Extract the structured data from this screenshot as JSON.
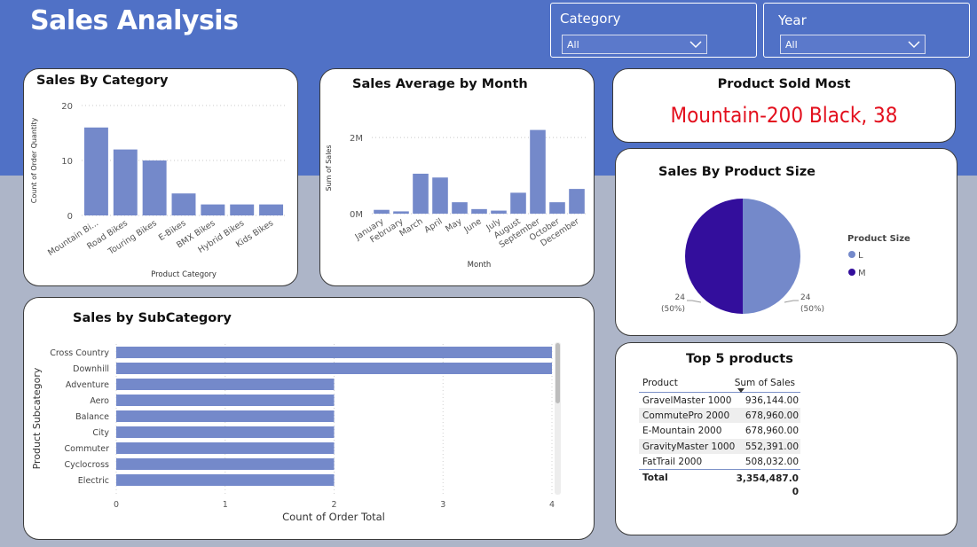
{
  "header": {
    "title": "Sales Analysis",
    "filters": [
      {
        "label": "Category",
        "value": "All"
      },
      {
        "label": "Year",
        "value": "All"
      }
    ]
  },
  "sales_by_category": {
    "title": "Sales By Category",
    "chart_data": {
      "type": "bar",
      "title": "Sales By Category",
      "xlabel": "Product Category",
      "ylabel": "Count of Order Quantity",
      "categories": [
        "Mountain Bi...",
        "Road Bikes",
        "Touring Bikes",
        "E-Bikes",
        "BMX Bikes",
        "Hybrid Bikes",
        "Kids Bikes"
      ],
      "values": [
        16,
        12,
        10,
        4,
        2,
        2,
        2
      ],
      "ylim": [
        0,
        20
      ],
      "yticks": [
        "0",
        "10",
        "20"
      ],
      "color": "#7489ca",
      "grid": true
    }
  },
  "sales_by_month": {
    "title": "Sales Average by Month",
    "chart_data": {
      "type": "bar",
      "title": "Sales Average by Month",
      "xlabel": "Month",
      "ylabel": "Sum of Sales",
      "categories": [
        "January",
        "February",
        "March",
        "April",
        "May",
        "June",
        "July",
        "August",
        "September",
        "October",
        "December"
      ],
      "values": [
        100000,
        60000,
        1050000,
        950000,
        300000,
        120000,
        80000,
        550000,
        2200000,
        300000,
        650000
      ],
      "ylim": [
        0,
        2400000
      ],
      "yticks": [
        "0M",
        "2M"
      ],
      "color": "#7489ca",
      "grid": true
    }
  },
  "product_sold_most": {
    "title": "Product Sold Most",
    "value": "Mountain-200 Black, 38"
  },
  "sales_by_size": {
    "title": "Sales By Product Size",
    "legend_title": "Product Size",
    "chart_data": {
      "type": "pie",
      "title": "Sales By Product Size",
      "labels": [
        "L",
        "M"
      ],
      "values": [
        24,
        24
      ],
      "percent_labels": [
        "(50%)",
        "(50%)"
      ],
      "value_labels": [
        "24",
        "24"
      ],
      "colors": [
        "#7489ca",
        "#330e9c"
      ],
      "legend": "right"
    }
  },
  "sales_by_subcategory": {
    "title": "Sales by SubCategory",
    "chart_data": {
      "type": "bar",
      "orientation": "horizontal",
      "title": "Sales by SubCategory",
      "xlabel": "Count of Order Total",
      "ylabel": "Product Subcategory",
      "categories": [
        "Cross Country",
        "Downhill",
        "Adventure",
        "Aero",
        "Balance",
        "City",
        "Commuter",
        "Cyclocross",
        "Electric"
      ],
      "values": [
        4,
        4,
        2,
        2,
        2,
        2,
        2,
        2,
        2
      ],
      "xlim": [
        0,
        4
      ],
      "xticks": [
        "0",
        "1",
        "2",
        "3",
        "4"
      ],
      "color": "#7489ca",
      "grid": true
    }
  },
  "top_products": {
    "title": "Top 5 products",
    "columns": [
      "Product",
      "Sum of Sales"
    ],
    "rows": [
      [
        "GravelMaster 1000",
        "936,144.00"
      ],
      [
        "CommutePro 2000",
        "678,960.00"
      ],
      [
        "E-Mountain 2000",
        "678,960.00"
      ],
      [
        "GravityMaster 1000",
        "552,391.00"
      ],
      [
        "FatTrail 2000",
        "508,032.00"
      ]
    ],
    "total_label": "Total",
    "total_value": "3,354,487.0 0"
  }
}
